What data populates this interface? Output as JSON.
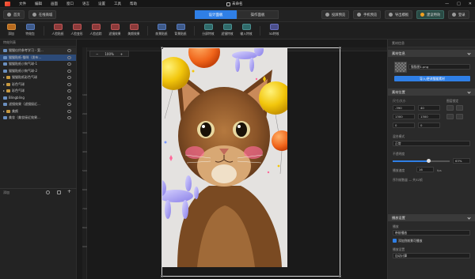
{
  "app": {
    "title": "未命名"
  },
  "menu": [
    "文件",
    "编辑",
    "画面",
    "窗口",
    "语言",
    "设置",
    "工具",
    "帮助"
  ],
  "window_buttons": [
    "—",
    "□",
    "✕"
  ],
  "nav": {
    "home": "首页",
    "online_store": "在线商城",
    "tab_design": "设计面板",
    "tab_operate": "操作面板",
    "live_preview": "投屏预览",
    "phone_preview": "手机预览",
    "export_template": "导出模板",
    "vip": "建议特效",
    "login": "登录"
  },
  "tools": [
    {
      "label": "添加",
      "color": "orange"
    },
    {
      "label": "特效包",
      "color": "blue"
    },
    {
      "label": "人脸贴纸",
      "color": "red"
    },
    {
      "label": "人脸变形",
      "color": "red"
    },
    {
      "label": "人脸追踪",
      "color": "red"
    },
    {
      "label": "滤镜效果",
      "color": "red"
    },
    {
      "label": "美颜效果",
      "color": "red"
    },
    {
      "label": "前景贴纸",
      "color": "blue"
    },
    {
      "label": "背景贴纸",
      "color": "blue"
    },
    {
      "label": "分屏特效",
      "color": "teal"
    },
    {
      "label": "滤镜特效",
      "color": "teal"
    },
    {
      "label": "输入特效",
      "color": "teal"
    },
    {
      "label": "3D特效",
      "color": "purple"
    }
  ],
  "left_panel": {
    "header": "特效列表",
    "layers": [
      {
        "label": "猫猫仪约参考学习 - 案...",
        "icon": "img",
        "state": "hl",
        "tri": false
      },
      {
        "label": "猫猫贴纸-猫咪（发布...",
        "icon": "img",
        "state": "sel",
        "tri": false
      },
      {
        "label": "猫猫贴纸小狗气球-1",
        "icon": "img",
        "state": "",
        "tri": false
      },
      {
        "label": "猫猫贴纸小狗气球-2",
        "icon": "img",
        "state": "",
        "tri": false
      },
      {
        "label": "猫猫贴纸彩色气球",
        "icon": "folder",
        "state": "",
        "tri": true
      },
      {
        "label": "彩色气球",
        "icon": "folder",
        "state": "",
        "tri": true
      },
      {
        "label": "彩色气球",
        "icon": "folder",
        "state": "",
        "tri": true
      },
      {
        "label": "Blingbling",
        "icon": "img",
        "state": "",
        "tri": false
      },
      {
        "label": "滤镜效果（滤镜接近...",
        "icon": "img",
        "state": "",
        "tri": false
      },
      {
        "label": "美颜",
        "icon": "folder",
        "state": "",
        "tri": true
      },
      {
        "label": "美妆（美妆接近效果...",
        "icon": "img",
        "state": "",
        "tri": false
      }
    ],
    "footer": "添加"
  },
  "canvas": {
    "zoom": "100%",
    "zoom_minus": "−",
    "zoom_plus": "+",
    "ruler_left": [
      "100",
      "200",
      "300",
      "400",
      "500",
      "600",
      "700",
      "800",
      "900",
      "1000",
      "1100",
      "1200",
      "1300"
    ]
  },
  "right_panel": {
    "top_header": "素材信息",
    "material_section": "素材信息",
    "file_name": "猫猫图1.png",
    "upload_button": "导入/更改猫猫素材",
    "layout_section": "素材位置",
    "size_label": "尺寸/大小",
    "align_label": "图层锁定",
    "x": "-390",
    "y": "40",
    "w": "1300",
    "h": "1300",
    "rotate": "0",
    "rotate2": "0",
    "blend_label": "混合模式",
    "blend_value": "正常",
    "opacity_label": "不透明度",
    "opacity_value": "63%",
    "duration_label": "播放速度",
    "duration_value": "16",
    "duration_unit": "fps",
    "note": "序列帧数量 — 共32帧",
    "anim_section": "播放设置",
    "loop_label": "播放",
    "loop_value": "带前播放",
    "checkbox_label": "添加到前景可播放",
    "start_label": "播放设置",
    "start_value": "自动计算"
  }
}
